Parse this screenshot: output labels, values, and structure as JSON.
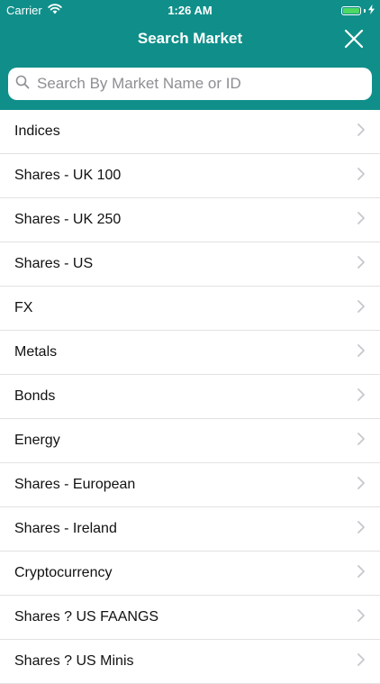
{
  "status_bar": {
    "carrier": "Carrier",
    "time": "1:26 AM"
  },
  "header": {
    "title": "Search Market",
    "close_icon": "close-icon",
    "bg_color": "#108f8a"
  },
  "search": {
    "placeholder": "Search By Market Name or ID",
    "value": ""
  },
  "markets": [
    {
      "label": "Indices"
    },
    {
      "label": "Shares - UK 100"
    },
    {
      "label": "Shares - UK 250"
    },
    {
      "label": "Shares - US"
    },
    {
      "label": "FX"
    },
    {
      "label": "Metals"
    },
    {
      "label": "Bonds"
    },
    {
      "label": "Energy"
    },
    {
      "label": "Shares - European"
    },
    {
      "label": "Shares - Ireland"
    },
    {
      "label": "Cryptocurrency"
    },
    {
      "label": "Shares ? US FAANGS"
    },
    {
      "label": "Shares ? US Minis"
    }
  ]
}
